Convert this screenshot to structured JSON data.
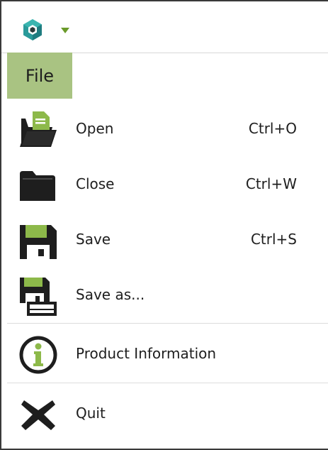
{
  "titlebar": {
    "app_icon": "app-logo-icon",
    "menu_arrow_icon": "chevron-down-icon"
  },
  "file_tab": {
    "label": "File"
  },
  "menu": {
    "items": [
      {
        "label": "Open",
        "shortcut": "Ctrl+O",
        "icon": "open-folder-document-icon"
      },
      {
        "label": "Close",
        "shortcut": "Ctrl+W",
        "icon": "folder-icon"
      },
      {
        "label": "Save",
        "shortcut": "Ctrl+S",
        "icon": "floppy-disk-icon"
      },
      {
        "label": "Save as...",
        "shortcut": "",
        "icon": "floppy-disk-edit-icon"
      },
      {
        "label": "Product Information",
        "shortcut": "",
        "icon": "info-icon"
      },
      {
        "label": "Quit",
        "shortcut": "",
        "icon": "close-x-icon"
      }
    ]
  },
  "colors": {
    "accent_green": "#8db94a",
    "file_tab_bg": "#a9c382",
    "logo_teal": "#2a9a9a",
    "icon_dark": "#1e1e1e"
  }
}
